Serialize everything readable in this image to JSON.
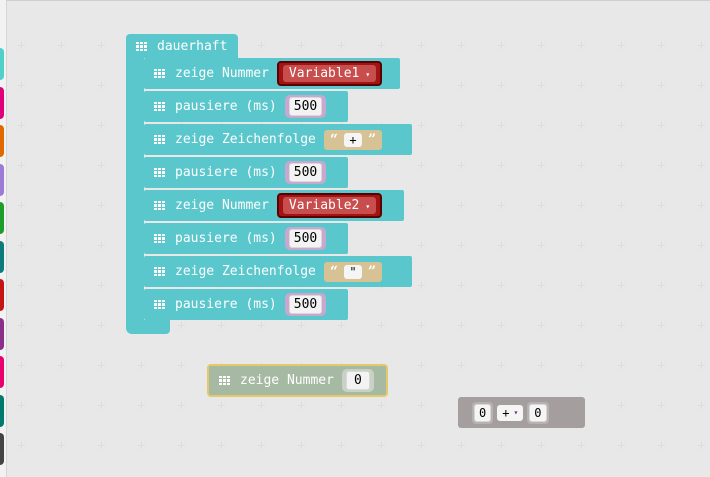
{
  "toolbox": {
    "colors": [
      "#4fd0c8",
      "#e0007a",
      "#e06a00",
      "#9b7bd6",
      "#1d9d2a",
      "#0f7a7a",
      "#c41414",
      "#8a2f8a",
      "#e8006f",
      "#007a6a",
      "#444444"
    ]
  },
  "forever_block": {
    "label": "dauerhaft",
    "color": "#5ac7cc",
    "statements": [
      {
        "label": "zeige Nummer",
        "kind": "variable",
        "value": "Variable1"
      },
      {
        "label": "pausiere (ms)",
        "kind": "number",
        "value": "500"
      },
      {
        "label": "zeige Zeichenfolge",
        "kind": "string",
        "value": "+"
      },
      {
        "label": "pausiere (ms)",
        "kind": "number",
        "value": "500"
      },
      {
        "label": "zeige Nummer",
        "kind": "variable",
        "value": "Variable2"
      },
      {
        "label": "pausiere (ms)",
        "kind": "number",
        "value": "500"
      },
      {
        "label": "zeige Zeichenfolge",
        "kind": "string",
        "value": "\""
      },
      {
        "label": "pausiere (ms)",
        "kind": "number",
        "value": "500"
      }
    ]
  },
  "floating_block": {
    "label": "zeige Nummer",
    "value": "0"
  },
  "math_block": {
    "left": "0",
    "operator": "+",
    "right": "0"
  },
  "glyphs": {
    "dropdown": "▾",
    "open_quote": "“",
    "close_quote": "”"
  }
}
